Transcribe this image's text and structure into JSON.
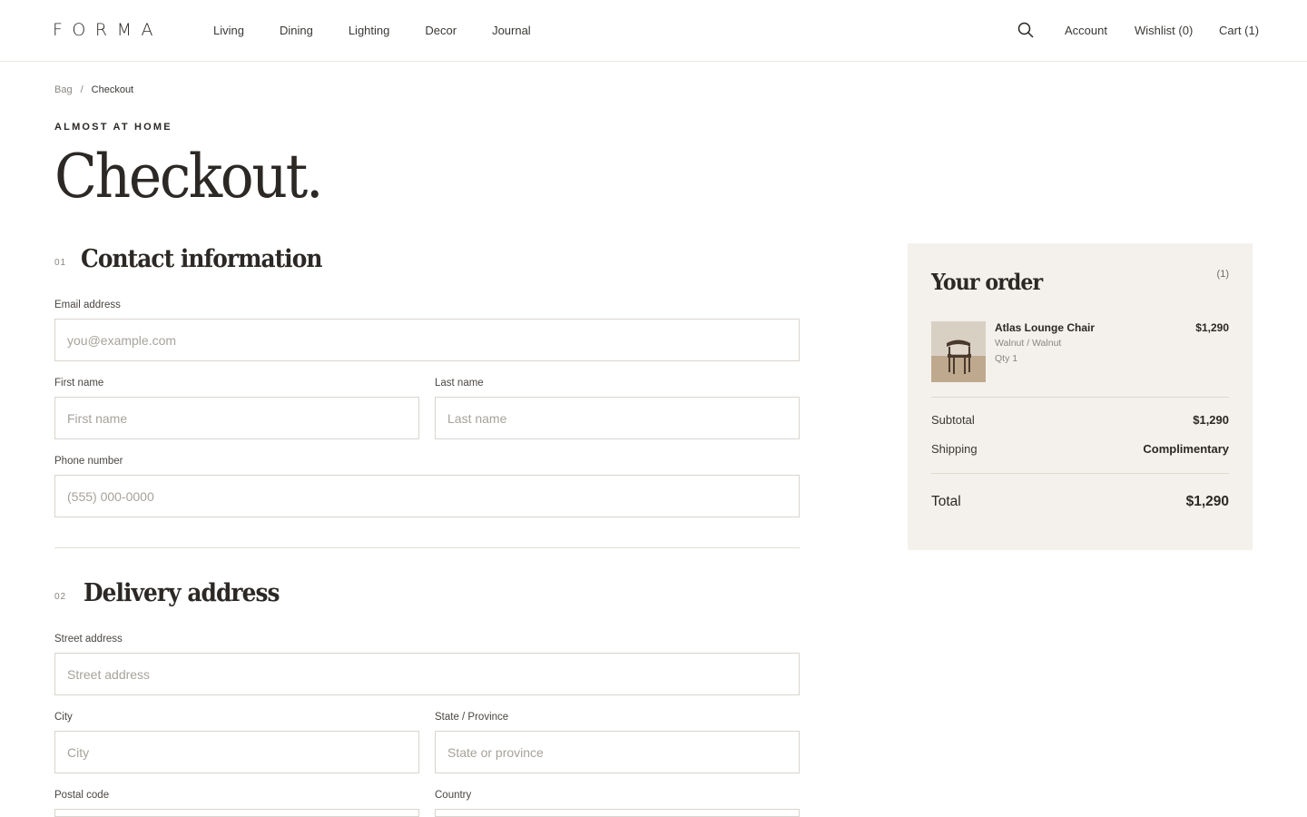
{
  "header": {
    "logo": "FORMA",
    "nav": [
      "Living",
      "Dining",
      "Lighting",
      "Decor",
      "Journal"
    ],
    "account": "Account",
    "wishlist": "Wishlist (0)",
    "cart": "Cart (1)"
  },
  "breadcrumb": {
    "parent": "Bag",
    "separator": "/",
    "current": "Checkout"
  },
  "hero": {
    "eyebrow": "ALMOST AT HOME",
    "title": "Checkout."
  },
  "contact": {
    "number": "01",
    "title": "Contact information",
    "email_label": "Email address",
    "email_placeholder": "you@example.com",
    "first_label": "First name",
    "first_placeholder": "First name",
    "last_label": "Last name",
    "last_placeholder": "Last name",
    "phone_label": "Phone number",
    "phone_placeholder": "(555) 000-0000"
  },
  "delivery": {
    "number": "02",
    "title": "Delivery address",
    "street_label": "Street address",
    "street_placeholder": "Street address",
    "city_label": "City",
    "city_placeholder": "City",
    "state_label": "State / Province",
    "state_placeholder": "State or province",
    "postal_label": "Postal code",
    "country_label": "Country"
  },
  "order": {
    "title": "Your order",
    "count": "(1)",
    "item": {
      "name": "Atlas Lounge Chair",
      "variant": "Walnut / Walnut",
      "qty": "Qty 1",
      "price": "$1,290"
    },
    "subtotal_label": "Subtotal",
    "subtotal": "$1,290",
    "shipping_label": "Shipping",
    "shipping": "Complimentary",
    "total_label": "Total",
    "total": "$1,290"
  },
  "colors": {
    "text": "#2b2825",
    "summary_bg": "#f4f1ec",
    "border": "#d9d5cf"
  }
}
